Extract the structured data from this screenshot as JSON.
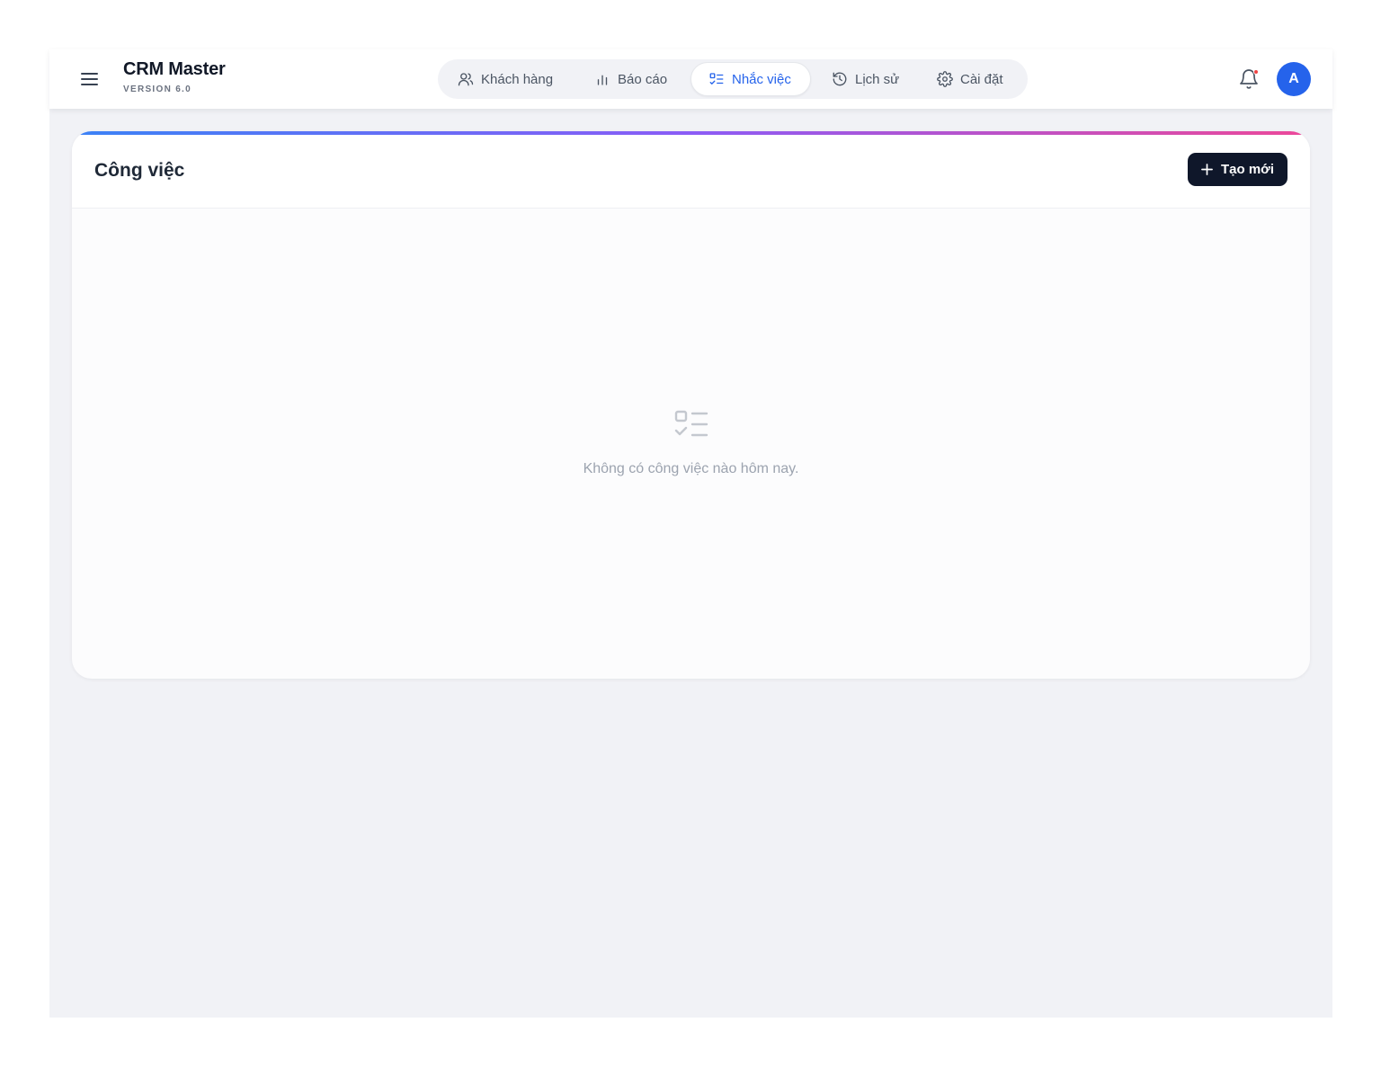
{
  "app": {
    "title": "CRM Master",
    "version": "VERSION 6.0"
  },
  "nav": {
    "items": [
      {
        "label": "Khách hàng",
        "icon": "users-icon",
        "active": false
      },
      {
        "label": "Báo cáo",
        "icon": "bar-chart-icon",
        "active": false
      },
      {
        "label": "Nhắc việc",
        "icon": "checklist-icon",
        "active": true
      },
      {
        "label": "Lịch sử",
        "icon": "history-icon",
        "active": false
      },
      {
        "label": "Cài đặt",
        "icon": "gear-icon",
        "active": false
      }
    ]
  },
  "header": {
    "notifications_icon": "bell-icon",
    "has_unread": true,
    "avatar_initial": "A"
  },
  "tasks": {
    "title": "Công việc",
    "create_label": "Tạo mới",
    "empty_message": "Không có công việc nào hôm nay.",
    "empty_icon": "checklist-icon"
  },
  "colors": {
    "accent": "#2563eb",
    "dark_button": "#0f172a",
    "gradient": [
      "#3b82f6",
      "#8b5cf6",
      "#ec4899"
    ],
    "unread_dot": "#ef4444"
  }
}
